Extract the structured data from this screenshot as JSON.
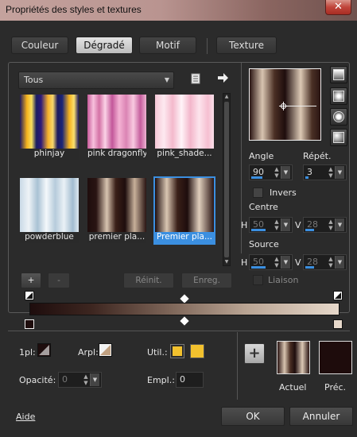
{
  "window": {
    "title": "Propriétés des styles et textures",
    "close": "✕"
  },
  "tabs": [
    {
      "label": "Couleur"
    },
    {
      "label": "Dégradé"
    },
    {
      "label": "Motif"
    },
    {
      "label": "Texture"
    }
  ],
  "category": {
    "value": "Tous"
  },
  "gradients": [
    {
      "name": "phinjay"
    },
    {
      "name": "pink dragonfly"
    },
    {
      "name": "pink_shade..."
    },
    {
      "name": "powderblue"
    },
    {
      "name": "premier pla..."
    },
    {
      "name": "Premier pla..."
    }
  ],
  "list_buttons": {
    "add": "+",
    "remove": "-",
    "reset": "Réinit.",
    "save": "Enreg."
  },
  "settings": {
    "angle_label": "Angle",
    "angle_value": "90",
    "repeat_label": "Répét.",
    "repeat_value": "3",
    "invert_label": "Invers",
    "center_label": "Centre",
    "center_h_label": "H",
    "center_h": "50",
    "center_v_label": "V",
    "center_v": "28",
    "source_label": "Source",
    "source_h_label": "H",
    "source_h": "50",
    "source_v_label": "V",
    "source_v": "28",
    "link_label": "Liaison"
  },
  "stops": {
    "fg_label": "1pl:",
    "bg_label": "Arpl:",
    "user_label": "Util.:",
    "opacity_label": "Opacité:",
    "opacity_value": "0",
    "location_label": "Empl.:",
    "location_value": "0"
  },
  "preview": {
    "current_label": "Actuel",
    "previous_label": "Préc."
  },
  "footer": {
    "help": "Aide",
    "ok": "OK",
    "cancel": "Annuler"
  },
  "colors": {
    "accent": "#3b8fe0",
    "user_color": "#f2c12e",
    "previous_color": "#1e0c0c"
  },
  "icons": {
    "gradient_types": [
      "linear",
      "rectangular",
      "sunburst",
      "radial"
    ],
    "file_icon": "document",
    "arrow_icon": "arrow-right"
  }
}
